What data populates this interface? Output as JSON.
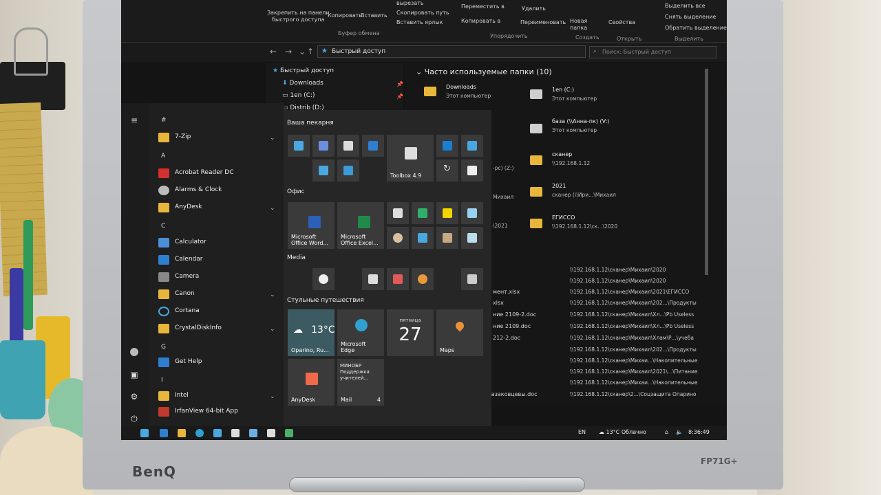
{
  "monitor": {
    "brand": "BenQ",
    "model": "FP71G+"
  },
  "ribbon": {
    "pin_quick_access": "Закрепить на панели\nбыстрого доступа",
    "copy": "Копировать",
    "paste": "Вставить",
    "cut": "вырезать",
    "copy_path": "Скопировать путь",
    "paste_shortcut": "Вставить ярлык",
    "move_to": "Переместить в",
    "copy_to": "Копировать в",
    "delete": "Удалить",
    "rename": "Переименовать",
    "new_folder": "Новая\nпапка",
    "properties": "Свойства",
    "select_all": "Выделить все",
    "select_none": "Снять выделение",
    "invert_selection": "Обратить выделение",
    "group_clipboard": "Буфер обмена",
    "group_organize": "Упорядочить",
    "group_create": "Создать",
    "group_open": "Открыть",
    "group_select": "Выделить"
  },
  "address": {
    "path": "Быстрый доступ",
    "search_placeholder": "Поиск: Быстрый доступ"
  },
  "nav_pane": {
    "items": [
      {
        "label": "Быстрый доступ"
      },
      {
        "label": "Downloads"
      },
      {
        "label": "1en (C:)"
      },
      {
        "label": "Distrib (D:)"
      }
    ]
  },
  "frequent": {
    "title": "Часто используемые папки (10)",
    "folders": [
      {
        "name": "Downloads",
        "sub": "Этот компьютер"
      },
      {
        "name": "1en (C:)",
        "sub": "Этот компьютер"
      },
      {
        "name": "база (\\\\Анна-пк) (V:)",
        "sub": "Этот компьютер"
      },
      {
        "name": "сканер",
        "sub": "\\\\192.168.1.12"
      },
      {
        "name": "2021",
        "sub": "сканер (\\\\Ири...\\Михаил"
      },
      {
        "name": "ЕГИССО",
        "sub": "\\\\192.168.1.12\\ск...\\2020"
      }
    ],
    "partial_left": [
      "-pc) (Z:)",
      "Михаил",
      "\\2021"
    ]
  },
  "recent_files": {
    "names": [
      "мент.xlsx",
      "xlsx",
      "ние 2109-2.doc",
      "ние 2109.doc",
      "212-2.doc",
      "",
      "",
      "",
      "",
      "",
      "Казаковцевы.doc"
    ],
    "paths": [
      "\\\\192.168.1.12\\сканер\\Михаил\\2020",
      "\\\\192.168.1.12\\сканер\\Михаил\\2020",
      "\\\\192.168.1.12\\сканер\\Михаил\\2021\\ЕГИССО",
      "\\\\192.168.1.12\\сканер\\Михаил\\202...\\Продукты",
      "\\\\192.168.1.12\\сканер\\Михаил\\Хл...\\Pb Useless",
      "\\\\192.168.1.12\\сканер\\Михаил\\Хл...\\Pb Useless",
      "\\\\192.168.1.12\\сканер\\Михаил\\Хлам\\Р...\\учеба",
      "\\\\192.168.1.12\\сканер\\Михаил\\202...\\Продукты",
      "\\\\192.168.1.12\\сканер\\Михаи...\\Накопительные",
      "\\\\192.168.1.12\\сканер\\Михаил\\2021\\...\\Питание",
      "\\\\192.168.1.12\\сканер\\Михаи...\\Накопительные",
      "\\\\192.168.1.12\\сканер\\2...\\Соцзащита Опарино"
    ]
  },
  "start_menu": {
    "apps": [
      {
        "type": "letter",
        "text": "#"
      },
      {
        "type": "app",
        "label": "7-Zip",
        "color": "#e8b63b",
        "expand": true
      },
      {
        "type": "letter",
        "text": "A"
      },
      {
        "type": "app",
        "label": "Acrobat Reader DC",
        "color": "#d32f2f"
      },
      {
        "type": "app",
        "label": "Alarms & Clock",
        "color": "#bbbbbb"
      },
      {
        "type": "app",
        "label": "AnyDesk",
        "color": "#e8b63b",
        "expand": true
      },
      {
        "type": "letter",
        "text": "C"
      },
      {
        "type": "app",
        "label": "Calculator",
        "color": "#4a8fd8"
      },
      {
        "type": "app",
        "label": "Calendar",
        "color": "#2f7fd0"
      },
      {
        "type": "app",
        "label": "Camera",
        "color": "#888888"
      },
      {
        "type": "app",
        "label": "Canon",
        "color": "#e8b63b",
        "expand": true
      },
      {
        "type": "app",
        "label": "Cortana",
        "color": "#4aa8e0"
      },
      {
        "type": "app",
        "label": "CrystalDiskInfo",
        "color": "#e8b63b",
        "expand": true
      },
      {
        "type": "letter",
        "text": "G"
      },
      {
        "type": "app",
        "label": "Get Help",
        "color": "#2f7fd0"
      },
      {
        "type": "letter",
        "text": "I"
      },
      {
        "type": "app",
        "label": "Intel",
        "color": "#e8b63b",
        "expand": true
      },
      {
        "type": "app",
        "label": "IrfanView 64-bit App",
        "color": "#c0392b"
      }
    ],
    "groups": [
      {
        "title": "Ваша пекарня"
      },
      {
        "title": "Офис"
      },
      {
        "title": "Media"
      },
      {
        "title": "Стульные путешествия"
      }
    ],
    "tiles": {
      "toolbox": "Toolbox 4.9",
      "word": "Microsoft\nOffice Word...",
      "excel": "Microsoft\nOffice Excel...",
      "weather_temp": "13°C",
      "weather_loc": "Oparino, Ru...",
      "edge": "Microsoft\nEdge",
      "calendar_day": "пятница",
      "calendar_num": "27",
      "maps": "Maps",
      "anydesk": "AnyDesk",
      "mail_preview": "МИНОБР\nПоддержка\nучителей...",
      "mail": "Mail",
      "mail_count": "4"
    }
  },
  "taskbar": {
    "lang": "EN",
    "weather": "13°C Облачно",
    "time": "8:36:49"
  },
  "colors": {
    "folder": "#e8b63b",
    "accent": "#2f7fd0",
    "screen_bg": "#141414"
  }
}
